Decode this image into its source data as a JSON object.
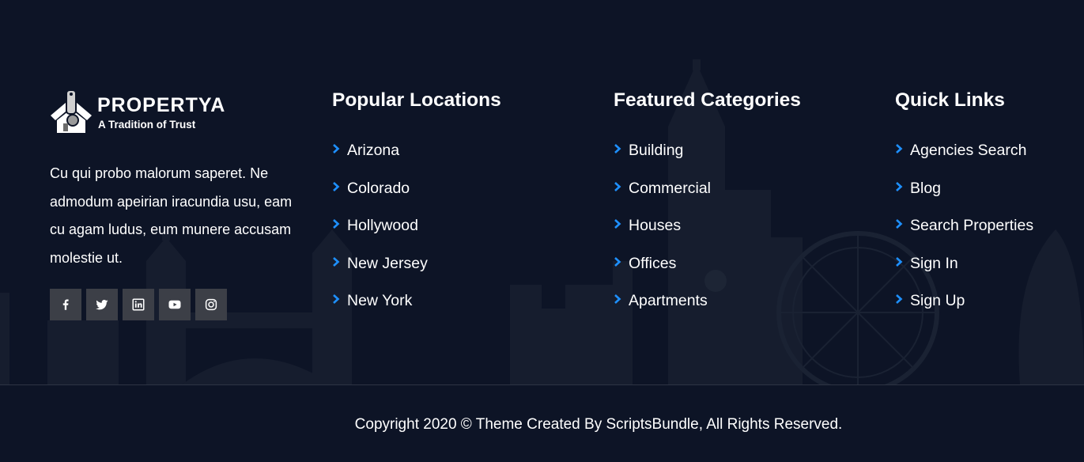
{
  "brand": {
    "name": "PROPERTYA",
    "tagline": "A Tradition of Trust"
  },
  "about": {
    "text": "Cu qui probo malorum saperet. Ne admodum apeirian iracundia usu, eam cu agam ludus, eum munere accusam molestie ut."
  },
  "social": [
    {
      "icon": "facebook-icon"
    },
    {
      "icon": "twitter-icon"
    },
    {
      "icon": "linkedin-icon"
    },
    {
      "icon": "youtube-icon"
    },
    {
      "icon": "instagram-icon"
    }
  ],
  "columns": {
    "locations": {
      "title": "Popular Locations",
      "items": [
        "Arizona",
        "Colorado",
        "Hollywood",
        "New Jersey",
        "New York"
      ]
    },
    "categories": {
      "title": "Featured Categories",
      "items": [
        "Building",
        "Commercial",
        "Houses",
        "Offices",
        "Apartments"
      ]
    },
    "quicklinks": {
      "title": "Quick Links",
      "items": [
        "Agencies Search",
        "Blog",
        "Search Properties",
        "Sign In",
        "Sign Up"
      ]
    }
  },
  "footer": {
    "copyright": "Copyright 2020 © Theme Created By ScriptsBundle, All Rights Reserved."
  },
  "colors": {
    "background": "#0d1426",
    "accent": "#1e90ff",
    "social_bg": "#3c3f47"
  }
}
